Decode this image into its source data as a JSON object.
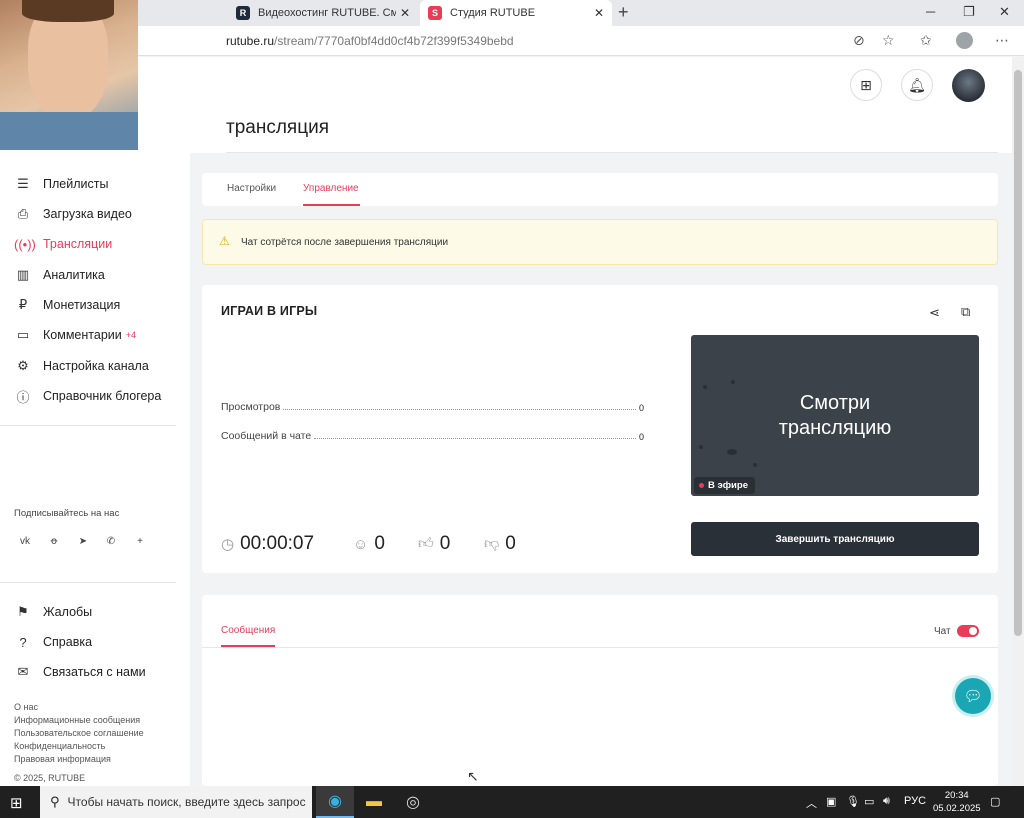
{
  "browser": {
    "tabs": [
      {
        "label": "Видеохостинг RUTUBE. Смотри",
        "icon": "rutube-logo"
      },
      {
        "label": "Студия RUTUBE",
        "icon": "rutube-studio-logo"
      }
    ],
    "url_domain": "rutube.ru",
    "url_path": "/stream/7770af0bf4dd0cf4b72f399f5349bebd"
  },
  "header": {
    "title": "трансляция"
  },
  "sidebar": {
    "items": [
      {
        "label": "Плейлисты",
        "icon": "list-icon"
      },
      {
        "label": "Загрузка видео",
        "icon": "upload-icon"
      },
      {
        "label": "Трансляции",
        "icon": "broadcast-icon",
        "active": true
      },
      {
        "label": "Аналитика",
        "icon": "chart-icon"
      },
      {
        "label": "Монетизация",
        "icon": "ruble-icon"
      },
      {
        "label": "Комментарии",
        "icon": "comment-icon",
        "badge": "+4"
      },
      {
        "label": "Настройка канала",
        "icon": "gear-icon"
      },
      {
        "label": "Справочник блогера",
        "icon": "info-icon"
      }
    ],
    "subscribe_label": "Подписывайтесь на нас",
    "social": [
      "vk",
      "ok",
      "telegram",
      "viber",
      "more"
    ],
    "bottom_items": [
      {
        "label": "Жалобы",
        "icon": "flag-icon"
      },
      {
        "label": "Справка",
        "icon": "help-icon"
      },
      {
        "label": "Связаться с нами",
        "icon": "mail-icon"
      }
    ],
    "footer_links": [
      "О нас",
      "Информационные сообщения",
      "Пользовательское соглашение",
      "Конфиденциальность",
      "Правовая информация",
      "© 2025, RUTUBE"
    ]
  },
  "main": {
    "tabs": [
      {
        "label": "Настройки"
      },
      {
        "label": "Управление",
        "active": true
      }
    ],
    "warning": "Чат сотрётся после завершения трансляции",
    "stream": {
      "title": "ИГРАИ В ИГРЫ",
      "stats": [
        {
          "label": "Просмотров",
          "value": "0"
        },
        {
          "label": "Сообщений в чате",
          "value": "0"
        }
      ],
      "preview_text_line1": "Смотри",
      "preview_text_line2": "трансляцию",
      "on_air_label": "В эфире",
      "end_button": "Завершить трансляцию",
      "duration": "00:00:07",
      "viewers": "0",
      "likes": "0",
      "dislikes": "0"
    },
    "messages": {
      "tab_label": "Сообщения",
      "chat_label": "Чат",
      "chat_enabled": true
    }
  },
  "taskbar": {
    "search_placeholder": "Чтобы начать поиск, введите здесь запрос",
    "language": "РУС",
    "time": "20:34",
    "date": "05.02.2025"
  },
  "colors": {
    "accent": "#e93c56",
    "dark_button": "#2a3038",
    "warning_bg": "#fdfbe7"
  }
}
